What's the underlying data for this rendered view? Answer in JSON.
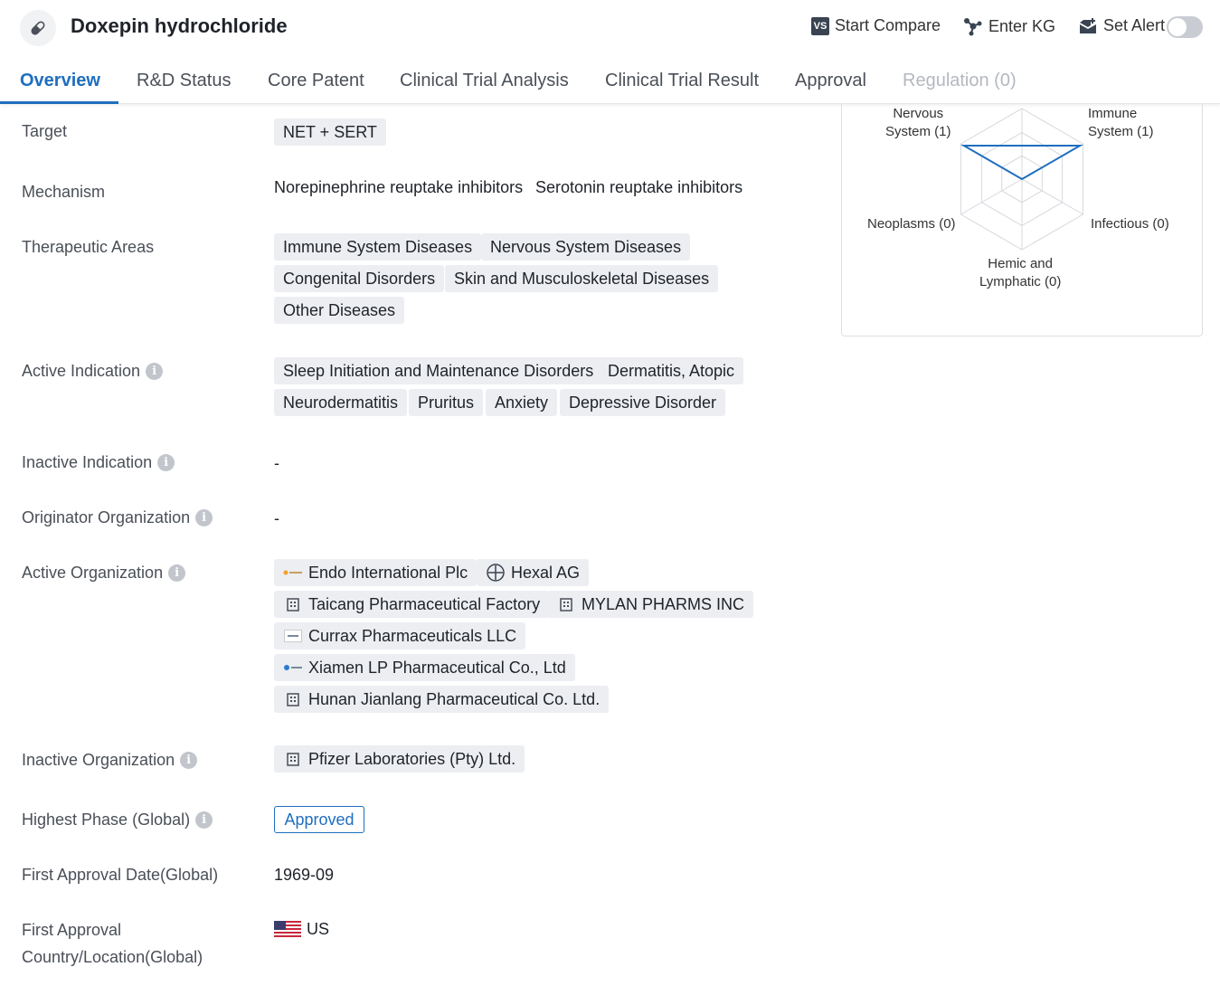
{
  "header": {
    "title": "Doxepin hydrochloride",
    "compare_label": "Start Compare",
    "compare_icon_text": "VS",
    "kg_label": "Enter KG",
    "alert_label": "Set Alert"
  },
  "tabs": [
    {
      "label": "Overview"
    },
    {
      "label": "R&D Status"
    },
    {
      "label": "Core Patent"
    },
    {
      "label": "Clinical Trial Analysis"
    },
    {
      "label": "Clinical Trial Result"
    },
    {
      "label": "Approval"
    },
    {
      "label": "Regulation (0)"
    }
  ],
  "fields": {
    "target": {
      "label": "Target",
      "values": [
        "NET + SERT"
      ]
    },
    "mechanism": {
      "label": "Mechanism",
      "values": [
        "Norepinephrine reuptake inhibitors",
        "Serotonin reuptake inhibitors"
      ]
    },
    "therapeutic_areas": {
      "label": "Therapeutic Areas",
      "values": [
        "Immune System Diseases",
        "Nervous System Diseases",
        "Congenital Disorders",
        "Skin and Musculoskeletal Diseases",
        "Other Diseases"
      ]
    },
    "active_indication": {
      "label": "Active Indication",
      "values": [
        "Sleep Initiation and Maintenance Disorders",
        "Dermatitis, Atopic",
        "Neurodermatitis",
        "Pruritus",
        "Anxiety",
        "Depressive Disorder"
      ]
    },
    "inactive_indication": {
      "label": "Inactive Indication",
      "value": "-"
    },
    "originator_org": {
      "label": "Originator Organization",
      "value": "-"
    },
    "active_org": {
      "label": "Active Organization",
      "values": [
        "Endo International Plc",
        "Hexal AG",
        "Taicang Pharmaceutical Factory",
        "MYLAN PHARMS INC",
        "Currax Pharmaceuticals LLC",
        "Xiamen LP Pharmaceutical Co., Ltd",
        "Hunan Jianlang Pharmaceutical Co. Ltd."
      ]
    },
    "inactive_org": {
      "label": "Inactive Organization",
      "values": [
        "Pfizer Laboratories (Pty) Ltd."
      ]
    },
    "highest_phase": {
      "label": "Highest Phase (Global)",
      "value": "Approved"
    },
    "first_approval_date": {
      "label": "First Approval Date(Global)",
      "value": "1969-09"
    },
    "first_approval_country": {
      "label_line1": "First Approval",
      "label_line2": "Country/Location(Global)",
      "value": "US"
    }
  },
  "radar": {
    "axes": [
      {
        "line1": "Nervous",
        "line2": "System (1)",
        "value": 1
      },
      {
        "line1": "Immune",
        "line2": "System (1)",
        "value": 1
      },
      {
        "line1": "Infectious (0)",
        "line2": "",
        "value": 0
      },
      {
        "line1": "Hemic and",
        "line2": "Lymphatic (0)",
        "value": 0
      },
      {
        "line1": "Neoplasms (0)",
        "line2": "",
        "value": 0
      }
    ],
    "max": 1,
    "line_color": "#1f6ebf"
  }
}
